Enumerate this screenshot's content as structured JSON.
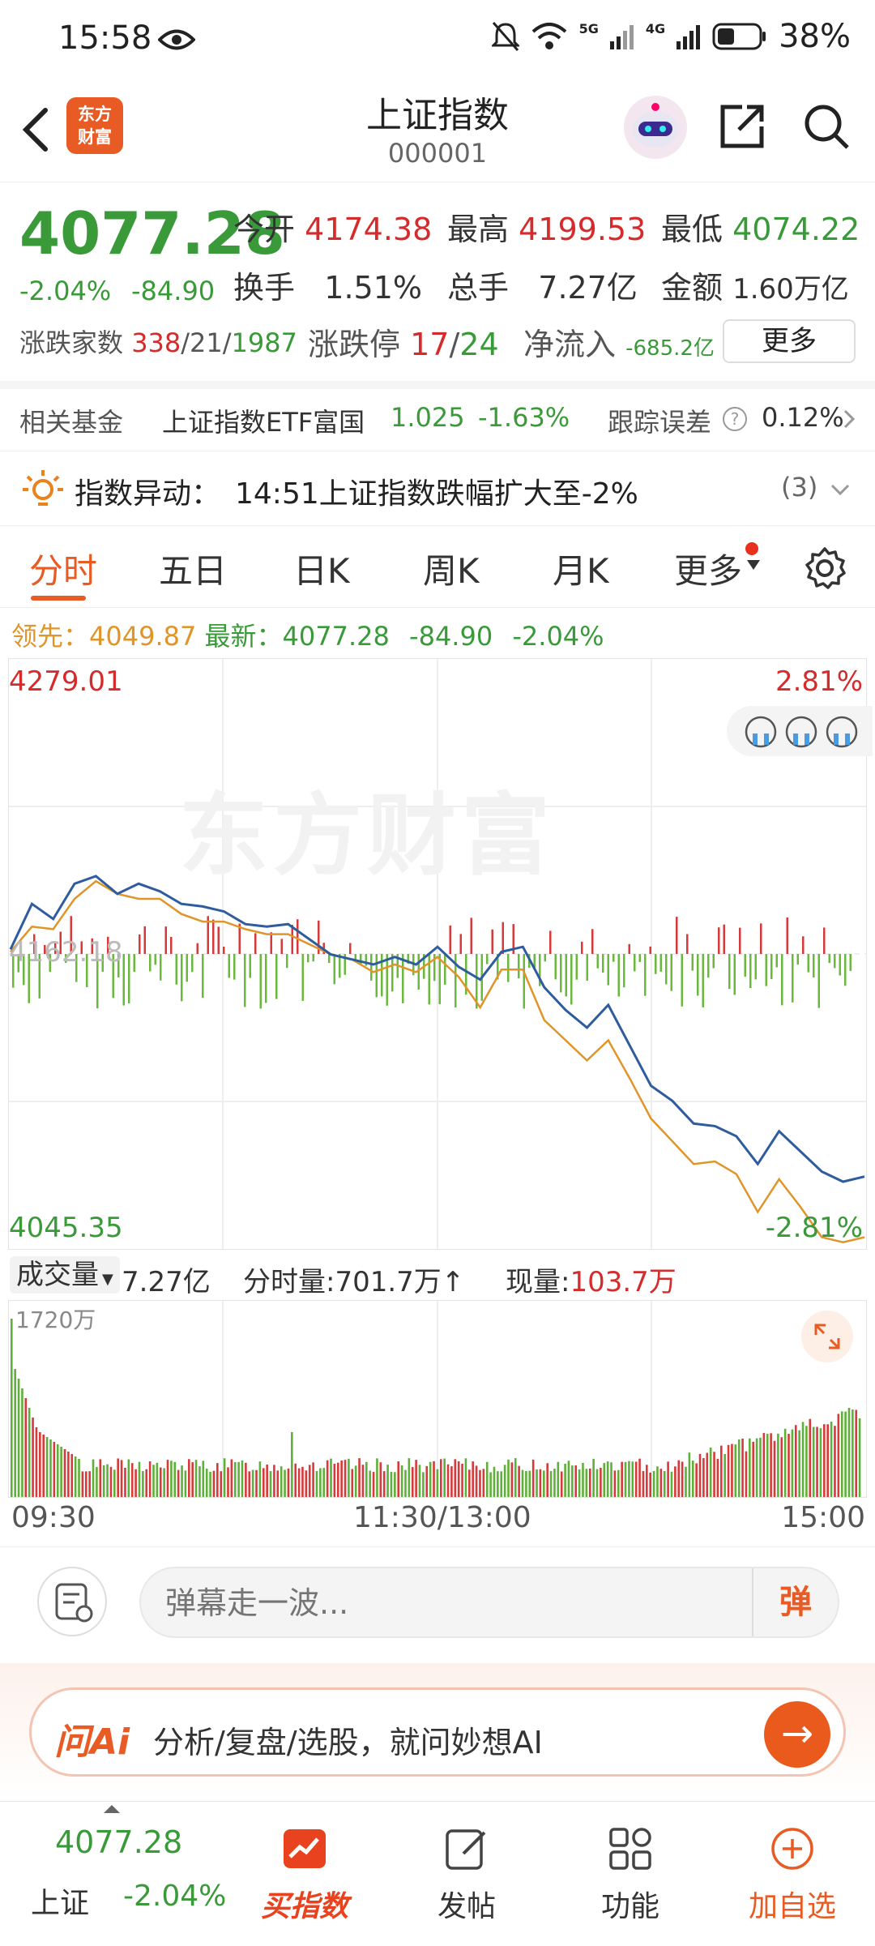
{
  "status_bar": {
    "time": "15:58",
    "network_5g": "5G",
    "network_4g": "4G",
    "battery": "38%"
  },
  "header": {
    "logo_text": "东方财富",
    "title": "上证指数",
    "code": "000001"
  },
  "quote": {
    "price": "4077.28",
    "change_pct": "-2.04%",
    "change_abs": "-84.90",
    "open_label": "今开",
    "open": "4174.38",
    "high_label": "最高",
    "high": "4199.53",
    "low_label": "最低",
    "low": "4074.22",
    "turnover_label": "换手",
    "turnover": "1.51%",
    "volume_label": "总手",
    "volume": "7.27亿",
    "amount_label": "金额",
    "amount": "1.60万亿",
    "breadth_label": "涨跌家数",
    "breadth_up": "338",
    "breadth_flat": "21",
    "breadth_down": "1987",
    "limit_label": "涨跌停",
    "limit_up": "17",
    "limit_down": "24",
    "netflow_label": "净流入",
    "netflow": "-685.2亿",
    "more_label": "更多"
  },
  "fund": {
    "label": "相关基金",
    "name": "上证指数ETF富国",
    "price": "1.025",
    "pct": "-1.63%",
    "tracking_label": "跟踪误差",
    "tracking": "0.12%"
  },
  "alert": {
    "label": "指数异动：",
    "text": "14:51上证指数跌幅扩大至-2%",
    "count": "(3)"
  },
  "tabs": [
    "分时",
    "五日",
    "日K",
    "周K",
    "月K",
    "更多"
  ],
  "legend": {
    "lead_label": "领先：",
    "lead": "4049.87",
    "latest_label": "最新：",
    "latest": "4077.28",
    "chg": "-84.90",
    "pct": "-2.04%"
  },
  "chart_labels": {
    "top_left": "4279.01",
    "top_right": "2.81%",
    "mid_left": "4162.18",
    "bottom_left": "4045.35",
    "bottom_right": "-2.81%",
    "watermark": "东方财富"
  },
  "volume_bar": {
    "selector": "成交量",
    "total": "7.27亿",
    "period_label": "分时量:",
    "period": "701.7万",
    "current_label": "现量:",
    "current": "103.7万",
    "max_label": "1720万"
  },
  "time_axis": {
    "start": "09:30",
    "mid": "11:30/13:00",
    "end": "15:00"
  },
  "danmu": {
    "placeholder": "弹幕走一波...",
    "button": "弹"
  },
  "ai": {
    "logo": "问Ai",
    "text": "分析/复盘/选股，就问妙想AI"
  },
  "bottom_nav": {
    "price": "4077.28",
    "name": "上证",
    "pct": "-2.04%",
    "items": [
      "买指数",
      "发帖",
      "功能",
      "加自选"
    ]
  },
  "colors": {
    "up": "#d42c2c",
    "down": "#3a9a3a",
    "accent": "#e85b25",
    "price_line": "#2f5c9e",
    "avg_line": "#e0952a"
  },
  "chart_data": {
    "type": "line",
    "x": [
      0,
      6,
      12,
      18,
      24,
      30,
      36,
      42,
      48,
      54,
      60,
      66,
      72,
      78,
      84,
      90,
      96,
      102,
      108,
      114,
      120,
      126,
      132,
      138,
      144,
      150,
      156,
      162,
      168,
      174,
      180,
      186,
      192,
      198,
      204,
      210,
      216,
      222,
      228,
      234,
      240
    ],
    "ylim": [
      4045.35,
      4279.01
    ],
    "series": [
      {
        "values": [
          4164,
          4182,
          4176,
          4190,
          4193,
          4186,
          4190,
          4187,
          4182,
          4181,
          4179,
          4174,
          4173,
          4174,
          4168,
          4162,
          4160,
          4158,
          4161,
          4158,
          4165,
          4157,
          4152,
          4163,
          4165,
          4149,
          4140,
          4133,
          4142,
          4126,
          4110,
          4104,
          4095,
          4094,
          4090,
          4079,
          4092,
          4084,
          4076,
          4072,
          4074
        ]
      },
      {
        "values": [
          4163,
          4173,
          4172,
          4184,
          4191,
          4186,
          4184,
          4184,
          4178,
          4175,
          4175,
          4172,
          4170,
          4170,
          4166,
          4162,
          4160,
          4155,
          4158,
          4155,
          4161,
          4153,
          4141,
          4156,
          4156,
          4136,
          4128,
          4120,
          4128,
          4113,
          4097,
          4088,
          4079,
          4080,
          4075,
          4060,
          4073,
          4062,
          4050,
          4048,
          4050
        ]
      }
    ]
  }
}
